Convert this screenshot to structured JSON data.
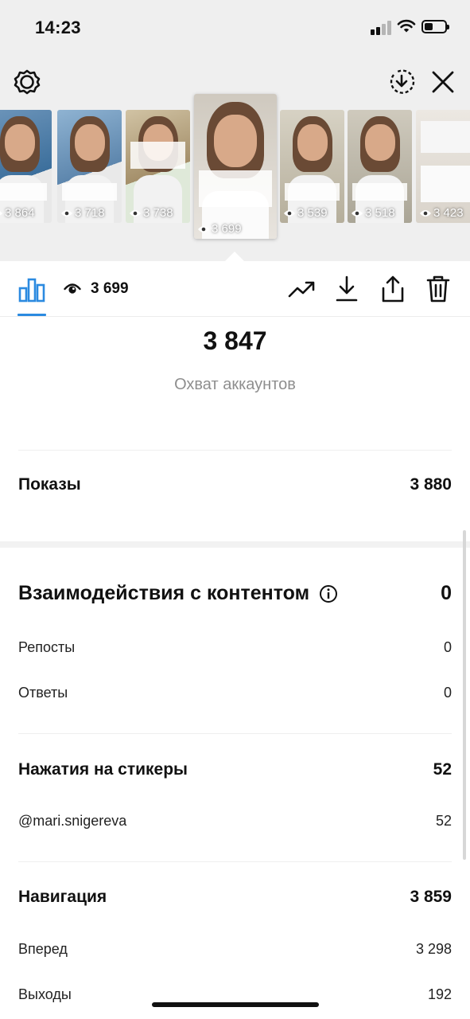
{
  "status_bar": {
    "time": "14:23"
  },
  "thumbnails": [
    {
      "views": "3 864",
      "bg": "#5d86ad"
    },
    {
      "views": "3 718",
      "bg": "#7aa0c0"
    },
    {
      "views": "3 738",
      "bg": "#b9aa8a"
    },
    {
      "views": "3 699",
      "bg": "#d6d0c6",
      "selected": true
    },
    {
      "views": "3 539",
      "bg": "#c7c2b2"
    },
    {
      "views": "3 518",
      "bg": "#bdb9ac"
    },
    {
      "views": "3 423",
      "bg": "#e6e2db"
    }
  ],
  "tabbar": {
    "views": "3 699"
  },
  "reach": {
    "value": "3 847",
    "label": "Охват аккаунтов"
  },
  "impressions": {
    "label": "Показы",
    "value": "3 880"
  },
  "interactions": {
    "label": "Взаимодействия с контентом",
    "value": "0",
    "items": [
      {
        "label": "Репосты",
        "value": "0"
      },
      {
        "label": "Ответы",
        "value": "0"
      }
    ]
  },
  "sticker_taps": {
    "label": "Нажатия на стикеры",
    "value": "52",
    "items": [
      {
        "label": "@mari.snigereva",
        "value": "52"
      }
    ]
  },
  "navigation": {
    "label": "Навигация",
    "value": "3 859",
    "items": [
      {
        "label": "Вперед",
        "value": "3 298"
      },
      {
        "label": "Выходы",
        "value": "192"
      }
    ]
  }
}
